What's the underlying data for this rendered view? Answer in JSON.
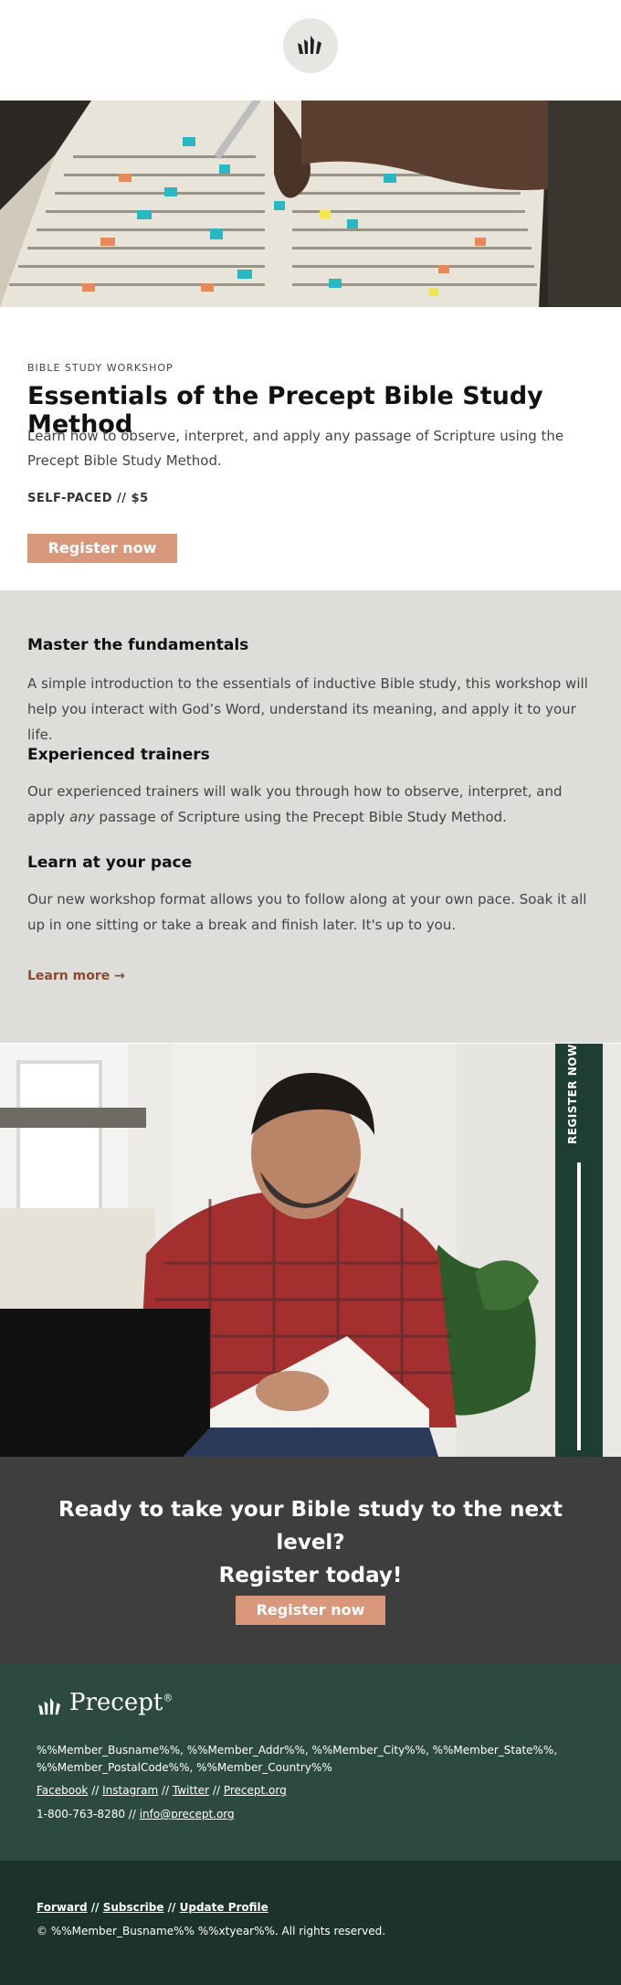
{
  "colors": {
    "accent": "#d9977b",
    "gray_band": "#deddd9",
    "dark_green": "#2c4a40",
    "darker_green": "#1b332c",
    "cta_bg": "#3e3e3e",
    "link_brown": "#8b4a2c"
  },
  "header": {
    "logo_icon": "precept-crown-icon"
  },
  "hero": {
    "image": "highlighted-bible-page-photo"
  },
  "intro": {
    "eyebrow": "BIBLE STUDY WORKSHOP",
    "title": "Essentials of the Precept Bible Study Method",
    "lede": "Learn how to observe, interpret, and apply any passage of Scripture using the Precept Bible Study Method.",
    "price": "SELF-PACED // $5",
    "button": "Register now"
  },
  "features": {
    "items": [
      {
        "heading": "Master the fundamentals",
        "body": "A simple introduction to the essentials of inductive Bible study, this workshop will help you interact with God’s Word, understand its meaning, and apply it to your life."
      },
      {
        "heading": "Experienced trainers",
        "body_before": "Our experienced trainers will walk you through how to observe, interpret, and apply ",
        "body_em": "any",
        "body_after": " passage of Scripture using the Precept Bible Study Method."
      },
      {
        "heading": "Learn at your pace",
        "body": "Our new workshop format allows you to follow along at your own pace. Soak it all up in one sitting or take a break and finish later. It's up to you."
      }
    ],
    "learn_more": "Learn more →"
  },
  "photo": {
    "image": "man-studying-bible-photo",
    "vertical_label": "REGISTER NOW"
  },
  "cta": {
    "line1": "Ready to take your Bible study to the next level?",
    "line2": "Register today!",
    "button": "Register now"
  },
  "footer": {
    "brand": "Precept",
    "brand_mark": "®",
    "address": "%%Member_Busname%%, %%Member_Addr%%, %%Member_City%%, %%Member_State%%, %%Member_PostalCode%%, %%Member_Country%%",
    "social": [
      "Facebook",
      "Instagram",
      "Twitter",
      "Precept.org"
    ],
    "separator": " // ",
    "phone": "1-800-763-8280",
    "email": "info@precept.org"
  },
  "footer2": {
    "links": [
      "Forward",
      "Subscribe",
      "Update Profile"
    ],
    "separator": " // ",
    "copyright": "© %%Member_Busname%% %%xtyear%%. All rights reserved."
  }
}
